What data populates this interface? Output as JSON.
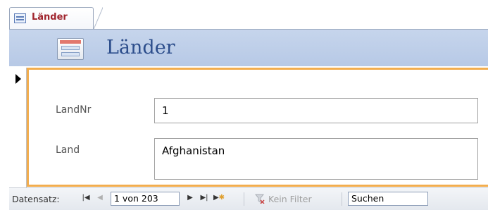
{
  "tab": {
    "label": "Länder",
    "icon": "form-icon"
  },
  "header": {
    "title": "Länder",
    "icon": "form-icon"
  },
  "record_selector": {
    "icon": "current-record-arrow-icon"
  },
  "fields": [
    {
      "label": "LandNr",
      "value": "1"
    },
    {
      "label": "Land",
      "value": "Afghanistan"
    }
  ],
  "navigation": {
    "label": "Datensatz:",
    "first_icon": "first-record-icon",
    "prev_icon": "previous-record-icon",
    "record_position": "1 von 203",
    "next_icon": "next-record-icon",
    "last_icon": "last-record-icon",
    "new_icon": "new-record-icon",
    "filter_label": "Kein Filter",
    "filter_icon": "filter-icon",
    "search_label": "Suchen"
  },
  "colors": {
    "tab_label": "#a0242d",
    "header_bg": "#c6d5ec",
    "header_title": "#2d4e8c",
    "detail_border": "#f2ad4e"
  }
}
